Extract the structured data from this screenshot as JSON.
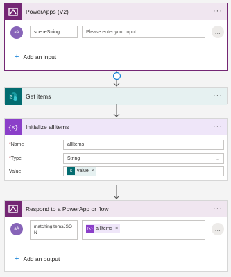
{
  "trigger": {
    "title": "PowerApps (V2)",
    "input_badge": "aA",
    "input_name": "sceneString",
    "input_placeholder": "Please enter your input",
    "more_label": "...",
    "add_input_label": "Add an input"
  },
  "get_items": {
    "title": "Get items"
  },
  "init_var": {
    "title": "Initialize allItems",
    "name_label": "Name",
    "name_value": "allItems",
    "type_label": "Type",
    "type_value": "String",
    "value_label": "Value",
    "value_token": "value",
    "required_mark": "*"
  },
  "respond": {
    "title": "Respond to a PowerApp or flow",
    "output_badge": "aA",
    "output_name": "matchingItemsJSON",
    "output_token": "allItems",
    "add_output_label": "Add an output"
  },
  "menu_dots": "···",
  "colors": {
    "powerapps_purple": "#742774",
    "sharepoint_teal": "#036c70",
    "variable_purple": "#8b3fc9",
    "header_pa": "#f0e6f0",
    "header_sp": "#e6f1f1",
    "header_var": "#efe6f9",
    "link_blue": "#0078d4"
  }
}
